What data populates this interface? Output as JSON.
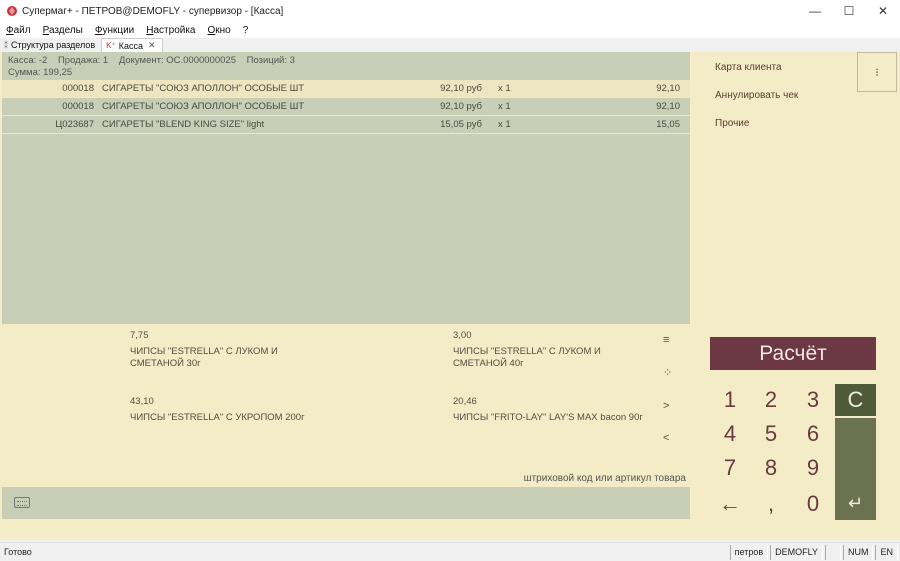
{
  "window": {
    "title": "Супермаг+ - ПЕТРОВ@DEMOFLY - супервизор - [Касса]",
    "controls": [
      "—",
      "☐",
      "✕"
    ]
  },
  "menu": [
    "Файл",
    "Разделы",
    "Функции",
    "Настройка",
    "Окно",
    "?"
  ],
  "tabs": [
    {
      "label": "Структура разделов",
      "icon": "tree-icon",
      "active": false
    },
    {
      "label": "Касса",
      "icon": "K⁺",
      "active": true,
      "close": "✕"
    }
  ],
  "summary": {
    "kassa": "Касса: -2",
    "sale": "Продажа: 1",
    "doc": "Документ: ОС.0000000025",
    "positions": "Позиций: 3",
    "total": "Сумма: 199,25"
  },
  "rows": [
    {
      "code": "000018",
      "name": "СИГАРЕТЫ \"СОЮЗ АПОЛЛОН\" ОСОБЫЕ ШТ",
      "price": "92,10 руб",
      "qty": "x 1",
      "sum": "92,10"
    },
    {
      "code": "000018",
      "name": "СИГАРЕТЫ \"СОЮЗ АПОЛЛОН\" ОСОБЫЕ ШТ",
      "price": "92,10 руб",
      "qty": "x 1",
      "sum": "92,10"
    },
    {
      "code": "Ц023687",
      "name": "СИГАРЕТЫ \"BLEND KING SIZE\" light",
      "price": "15,05 руб",
      "qty": "x 1",
      "sum": "15,05"
    }
  ],
  "quick_items": [
    {
      "price": "7,75",
      "name": "ЧИПСЫ \"ESTRELLA\" С ЛУКОМ И СМЕТАНОЙ 30г"
    },
    {
      "price": "3,00",
      "name": "ЧИПСЫ \"ESTRELLA\" С ЛУКОМ И СМЕТАНОЙ 40г"
    },
    {
      "price": "43,10",
      "name": "ЧИПСЫ \"ESTRELLA\" С УКРОПОМ 200г"
    },
    {
      "price": "20,46",
      "name": "ЧИПСЫ \"FRITO-LAY\" LAY'S MAX bacon 90г"
    }
  ],
  "quick_nav": [
    "≡",
    "⁘",
    ">",
    "<"
  ],
  "input_hint": "штриховой код или артикул товара",
  "side": {
    "links": [
      "Карта клиента",
      "Аннулировать чек",
      "Прочие"
    ],
    "corner_button": "⁝",
    "calc_label": "Расчёт",
    "keys": [
      "1",
      "2",
      "3",
      "4",
      "5",
      "6",
      "7",
      "8",
      "9",
      "←",
      ",",
      "0"
    ],
    "clear_label": "C",
    "enter_label": "↵"
  },
  "status": {
    "text": "Готово",
    "user": "петров",
    "db": "DEMOFLY",
    "empty": "",
    "num": "NUM",
    "lang": "EN"
  },
  "colors": {
    "beige": "#f3ecc7",
    "sage": "#c8cfb6",
    "calc": "#6b3844",
    "clear": "#4f5a3a",
    "enter": "#6b7250"
  }
}
